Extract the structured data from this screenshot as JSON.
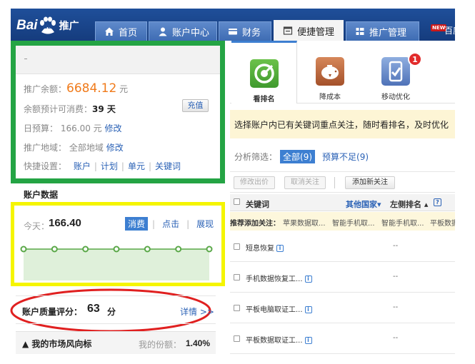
{
  "nav": {
    "logo_text_1": "Bai",
    "logo_text_2": "du",
    "logo_product": "推广",
    "tabs": [
      {
        "label": "首页",
        "icon": "home-icon"
      },
      {
        "label": "账户中心",
        "icon": "user-icon"
      },
      {
        "label": "财务",
        "icon": "card-icon"
      },
      {
        "label": "便捷管理",
        "icon": "window-icon",
        "active": true
      },
      {
        "label": "推广管理",
        "icon": "grid-icon"
      }
    ],
    "new_badge": "NEW",
    "extra_link": "百度推"
  },
  "account": {
    "balance_label": "推广余额：",
    "balance_value": "6684.12",
    "balance_unit": "元",
    "estimate_label": "余额预计可消费：",
    "estimate_value": "39 天",
    "recharge_label": "充值",
    "budget_label": "日预算：",
    "budget_value": "166.00 元",
    "budget_edit": "修改",
    "region_label": "推广地域：",
    "region_value": "全部地域",
    "region_edit": "修改",
    "shortcut_label": "快捷设置：",
    "shortcuts": [
      "账户",
      "计划",
      "单元",
      "关键词"
    ]
  },
  "account_data": {
    "title": "账户数据",
    "today_label": "今天：",
    "today_value": "166.40",
    "metric_tabs": [
      "消费",
      "点击",
      "展现"
    ],
    "selected_metric": "消费",
    "trend_points": [
      0.5,
      0.5,
      0.5,
      0.5,
      0.5,
      0.5,
      0.5
    ]
  },
  "quality": {
    "label": "账户质量评分：",
    "score": "63",
    "unit": "分",
    "detail_link": "详情 >>"
  },
  "market": {
    "title": "▲ 我的市场风向标",
    "share_label": "我的份额：",
    "share_value": "1.40%"
  },
  "tools": [
    {
      "label": "看排名",
      "icon": "ranking-target-icon",
      "color": "#4aa83a",
      "selected": true
    },
    {
      "label": "降成本",
      "icon": "piggy-bank-icon",
      "color": "#b5653a"
    },
    {
      "label": "移动优化",
      "icon": "mobile-check-icon",
      "color": "#5b7fc4",
      "badge": "1"
    }
  ],
  "banner": {
    "text": "选择账户内已有关键词重点关注，随时看排名，及时优化"
  },
  "filter": {
    "label": "分析筛选：",
    "all": "全部(9)",
    "budget_short": "预算不足(9)"
  },
  "buttons": {
    "modify_bid": "修改出价",
    "cancel_follow": "取消关注",
    "add_follow": "添加新关注"
  },
  "table": {
    "col_keyword": "关键词",
    "col_region": "其他国家▾",
    "col_rank": "左侧排名 ▴",
    "help": "?",
    "recommend_label": "推荐添加关注：",
    "recommend_items": [
      "苹果数据取...",
      "智能手机取...",
      "智能手机取...",
      "平板数据"
    ],
    "rows": [
      {
        "keyword": "短息恢复",
        "rank": "--"
      },
      {
        "keyword": "手机数据恢复工...",
        "rank": "--"
      },
      {
        "keyword": "平板电脑取证工...",
        "rank": "--"
      },
      {
        "keyword": "平板数据取证工...",
        "rank": "--"
      }
    ]
  },
  "colors": {
    "nav_blue": "#1f4f9a",
    "highlight_green": "#24a444",
    "highlight_yellow": "#f5f500",
    "highlight_red": "#e02020",
    "balance_orange": "#f07a1a",
    "link_blue": "#2b62b6"
  }
}
